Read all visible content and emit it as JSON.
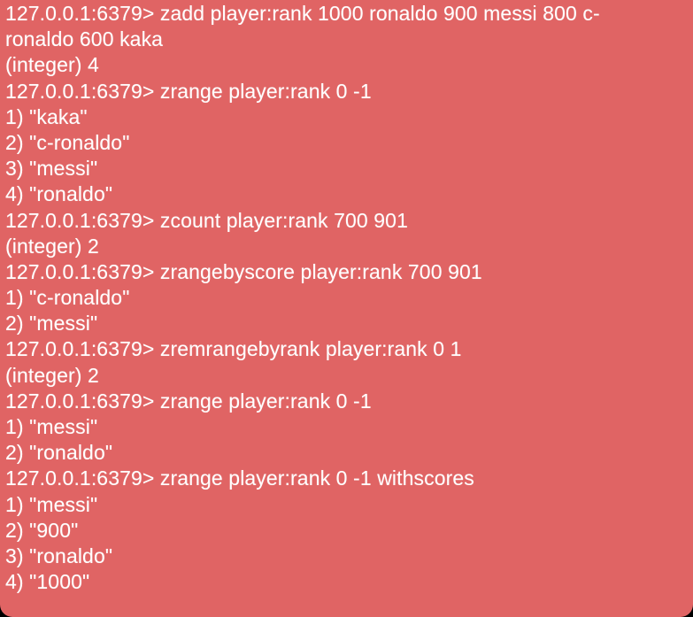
{
  "terminal": {
    "background_color": "#e06464",
    "text_color": "#ffffff",
    "lines": [
      "127.0.0.1:6379> zadd player:rank 1000 ronaldo 900 messi 800 c-",
      "ronaldo 600 kaka",
      "(integer) 4",
      "127.0.0.1:6379> zrange player:rank 0 -1",
      "1) \"kaka\"",
      "2) \"c-ronaldo\"",
      "3) \"messi\"",
      "4) \"ronaldo\"",
      "127.0.0.1:6379> zcount player:rank 700 901",
      "(integer) 2",
      "127.0.0.1:6379> zrangebyscore player:rank 700 901",
      "1) \"c-ronaldo\"",
      "2) \"messi\"",
      "127.0.0.1:6379> zremrangebyrank player:rank 0 1",
      "(integer) 2",
      "127.0.0.1:6379> zrange player:rank 0 -1",
      "1) \"messi\"",
      "2) \"ronaldo\"",
      "127.0.0.1:6379> zrange player:rank 0 -1 withscores",
      "1) \"messi\"",
      "2) \"900\"",
      "3) \"ronaldo\"",
      "4) \"1000\""
    ]
  }
}
